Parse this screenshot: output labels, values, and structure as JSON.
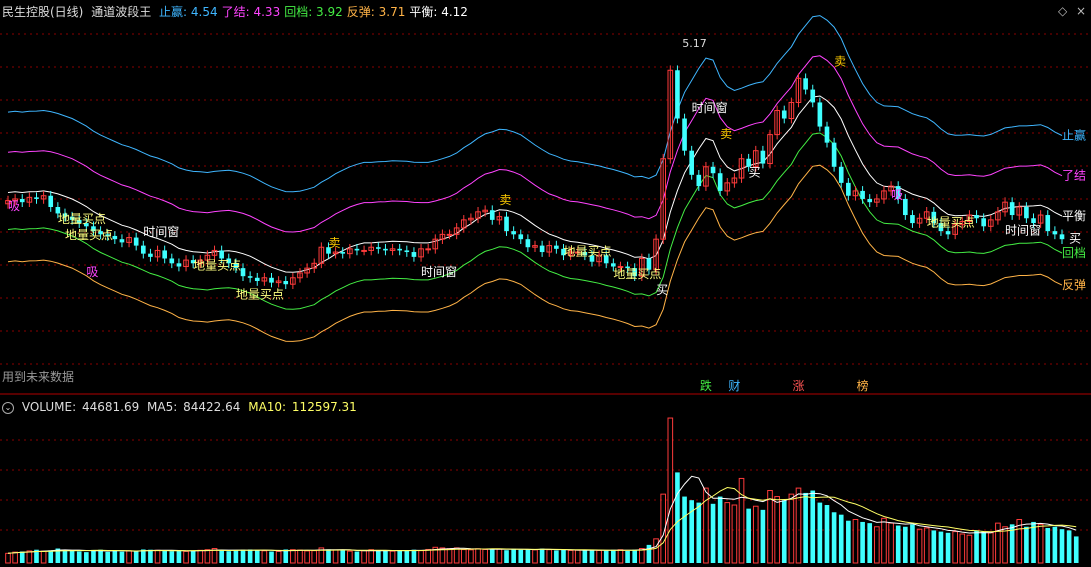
{
  "header": {
    "stock": "民生控股(日线)",
    "indicator": "通道波段王",
    "items": [
      {
        "label": "止赢:",
        "value": "4.54",
        "color": "#3fb6ff"
      },
      {
        "label": "了结:",
        "value": "4.33",
        "color": "#ff44ff"
      },
      {
        "label": "回档:",
        "value": "3.92",
        "color": "#44ee44"
      },
      {
        "label": "反弹:",
        "value": "3.71",
        "color": "#ffb347"
      },
      {
        "label": "平衡:",
        "value": "4.12",
        "color": "#ffffff"
      }
    ]
  },
  "volume_header": {
    "label": "VOLUME:",
    "value": "44681.69",
    "ma5_label": "MA5:",
    "ma5_value": "84422.64",
    "ma10_label": "MA10:",
    "ma10_value": "112597.31"
  },
  "future_note": "用到未来数据",
  "colors": {
    "up": "#ff3b3b",
    "down": "#3fffff",
    "grid": "#8a0000"
  },
  "chart_data": {
    "type": "candlestick",
    "price_ylim": [
      3.0,
      5.3
    ],
    "volume_ylim": [
      0,
      125000
    ],
    "high_label": "5.17",
    "closes": [
      4.19,
      4.2,
      4.18,
      4.21,
      4.2,
      4.22,
      4.15,
      4.11,
      4.09,
      4.07,
      4.05,
      4.03,
      4.0,
      3.98,
      3.97,
      3.95,
      3.93,
      3.96,
      3.91,
      3.86,
      3.84,
      3.88,
      3.83,
      3.8,
      3.78,
      3.82,
      3.8,
      3.82,
      3.85,
      3.88,
      3.83,
      3.8,
      3.77,
      3.72,
      3.71,
      3.69,
      3.71,
      3.68,
      3.69,
      3.67,
      3.71,
      3.74,
      3.77,
      3.8,
      3.9,
      3.86,
      3.87,
      3.86,
      3.89,
      3.88,
      3.88,
      3.9,
      3.89,
      3.88,
      3.89,
      3.88,
      3.87,
      3.84,
      3.89,
      3.89,
      3.95,
      3.98,
      3.98,
      4.02,
      4.07,
      4.08,
      4.12,
      4.13,
      4.07,
      4.09,
      4.0,
      3.98,
      3.95,
      3.9,
      3.91,
      3.87,
      3.91,
      3.89,
      3.85,
      3.87,
      3.87,
      3.85,
      3.81,
      3.85,
      3.8,
      3.78,
      3.78,
      3.77,
      3.72,
      3.83,
      3.76,
      3.95,
      4.45,
      5.0,
      4.7,
      4.5,
      4.35,
      4.28,
      4.4,
      4.36,
      4.25,
      4.3,
      4.33,
      4.45,
      4.4,
      4.5,
      4.42,
      4.6,
      4.75,
      4.7,
      4.8,
      4.95,
      4.88,
      4.8,
      4.65,
      4.55,
      4.4,
      4.3,
      4.22,
      4.25,
      4.2,
      4.18,
      4.2,
      4.25,
      4.28,
      4.2,
      4.1,
      4.05,
      4.08,
      4.12,
      4.05,
      4.0,
      3.98,
      4.04,
      4.06,
      4.1,
      4.08,
      4.03,
      4.07,
      4.12,
      4.18,
      4.1,
      4.15,
      4.08,
      4.05,
      4.1,
      4.0,
      3.98,
      3.95
    ],
    "volumes": [
      8000,
      9000,
      9500,
      10000,
      11000,
      9800,
      10500,
      12000,
      11000,
      10200,
      9600,
      9000,
      10800,
      11000,
      9200,
      10300,
      9400,
      10100,
      10000,
      11200,
      11000,
      10500,
      10200,
      9800,
      10300,
      9600,
      10100,
      10500,
      11000,
      12000,
      10300,
      9800,
      10500,
      11000,
      11200,
      10600,
      10100,
      9500,
      9600,
      11200,
      11000,
      10700,
      10000,
      10200,
      12500,
      11300,
      10800,
      10500,
      9800,
      9500,
      10200,
      11000,
      10300,
      10100,
      9800,
      10700,
      10500,
      11000,
      10200,
      11200,
      13000,
      12500,
      11900,
      12500,
      11100,
      10900,
      11800,
      11200,
      12000,
      11500,
      10600,
      11700,
      11000,
      11300,
      10900,
      11900,
      11000,
      10400,
      11200,
      10400,
      10600,
      10500,
      10500,
      10400,
      10200,
      10900,
      11000,
      10000,
      11000,
      12000,
      15000,
      20000,
      57000,
      120000,
      75000,
      55000,
      52000,
      50000,
      62000,
      49000,
      55000,
      50000,
      48000,
      70000,
      45000,
      47000,
      44000,
      60000,
      55000,
      52000,
      57000,
      62000,
      58000,
      60000,
      50000,
      48000,
      42000,
      40000,
      35000,
      36000,
      34000,
      33000,
      30000,
      37000,
      33000,
      31000,
      30000,
      32000,
      28000,
      29000,
      27000,
      26000,
      25000,
      26000,
      24000,
      23000,
      27000,
      26000,
      25000,
      33000,
      30000,
      32000,
      36000,
      30000,
      34000,
      32000,
      29000,
      30000,
      28000,
      27000,
      22000
    ],
    "bands": [
      {
        "name": "止赢",
        "label_right": "止赢",
        "color": "#3fb6ff"
      },
      {
        "name": "了结",
        "label_right": "了结",
        "color": "#ff44ff"
      },
      {
        "name": "平衡",
        "label_right": "平衡",
        "color": "#ffffff"
      },
      {
        "name": "回档",
        "label_right": "回档",
        "color": "#44ee44"
      },
      {
        "name": "反弹",
        "label_right": "反弹",
        "color": "#ffb347"
      }
    ],
    "annotations": [
      {
        "text": "吸",
        "i": 0,
        "price": 4.13,
        "color": "#ff44ff"
      },
      {
        "text": "地量买点",
        "i": 7,
        "price": 4.05,
        "color": "#ffff80"
      },
      {
        "text": "地量买点",
        "i": 8,
        "price": 3.95,
        "color": "#ffff80"
      },
      {
        "text": "吸",
        "i": 11,
        "price": 3.72,
        "color": "#ff44ff"
      },
      {
        "text": "时间窗",
        "i": 19,
        "price": 3.97,
        "color": "#ffffff"
      },
      {
        "text": "地量买点",
        "i": 26,
        "price": 3.76,
        "color": "#ffff80"
      },
      {
        "text": "地量买点",
        "i": 32,
        "price": 3.58,
        "color": "#ffff80"
      },
      {
        "text": "卖",
        "i": 45,
        "price": 3.9,
        "color": "#ffcc00"
      },
      {
        "text": "时间窗",
        "i": 58,
        "price": 3.72,
        "color": "#ffffff"
      },
      {
        "text": "卖",
        "i": 69,
        "price": 4.17,
        "color": "#ffcc00"
      },
      {
        "text": "地量买点",
        "i": 78,
        "price": 3.85,
        "color": "#ffff80"
      },
      {
        "text": "地量买点",
        "i": 85,
        "price": 3.71,
        "color": "#ffff80"
      },
      {
        "text": "买",
        "i": 91,
        "price": 3.61,
        "color": "#ffffff"
      },
      {
        "text": "时间窗",
        "i": 96,
        "price": 4.74,
        "color": "#ffffff"
      },
      {
        "text": "卖",
        "i": 100,
        "price": 4.58,
        "color": "#ffcc00"
      },
      {
        "text": "买",
        "i": 104,
        "price": 4.34,
        "color": "#ffffff"
      },
      {
        "text": "卖",
        "i": 116,
        "price": 5.03,
        "color": "#ffcc00"
      },
      {
        "text": "吸",
        "i": 124,
        "price": 4.2,
        "color": "#ff44ff"
      },
      {
        "text": "地量买点",
        "i": 129,
        "price": 4.03,
        "color": "#ffff80"
      },
      {
        "text": "时间窗",
        "i": 140,
        "price": 3.98,
        "color": "#ffffff"
      },
      {
        "text": "买",
        "i": 149,
        "price": 3.93,
        "color": "#ffffff"
      }
    ],
    "markers": [
      {
        "text": "跌",
        "i": 98,
        "color": "#44ee44"
      },
      {
        "text": "财",
        "i": 102,
        "color": "#3fb6ff"
      },
      {
        "text": "涨",
        "i": 111,
        "color": "#ff5555"
      },
      {
        "text": "榜",
        "i": 120,
        "color": "#ffb347"
      }
    ]
  }
}
